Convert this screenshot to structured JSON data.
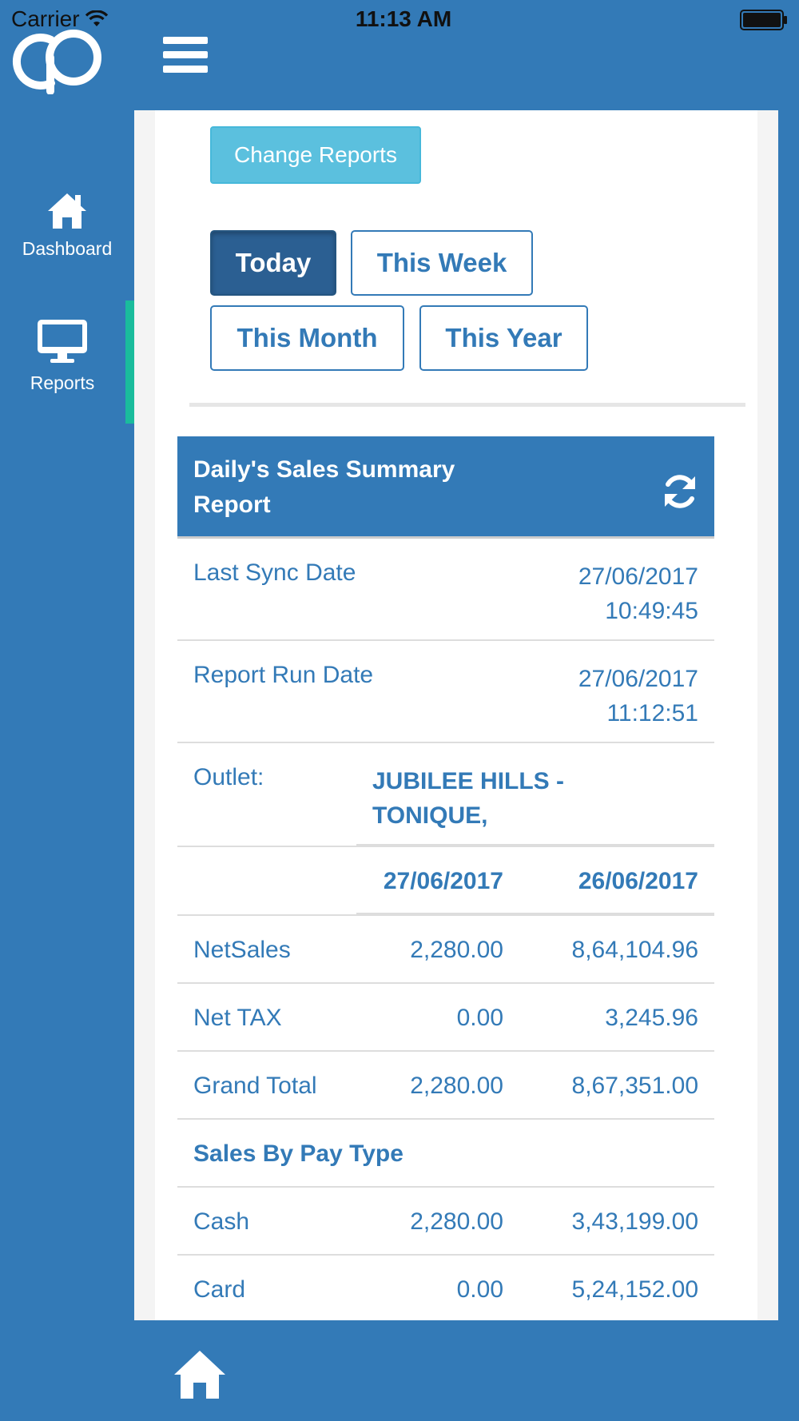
{
  "status_bar": {
    "carrier": "Carrier",
    "time": "11:13 AM"
  },
  "sidebar": {
    "items": [
      {
        "label": "Dashboard",
        "icon": "home-icon"
      },
      {
        "label": "Reports",
        "icon": "monitor-icon",
        "active": true
      }
    ]
  },
  "toolbar": {
    "change_reports_label": "Change Reports"
  },
  "periods": {
    "today": "Today",
    "this_week": "This Week",
    "this_month": "This Month",
    "this_year": "This Year",
    "selected": "Today"
  },
  "report": {
    "title_line1": "Daily's Sales Summary",
    "title_line2": "Report",
    "last_sync_label": "Last Sync Date",
    "last_sync_date": "27/06/2017",
    "last_sync_time": "10:49:45",
    "run_label": "Report Run Date",
    "run_date": "27/06/2017",
    "run_time": "11:12:51",
    "outlet_label": "Outlet:",
    "outlet_line1": "JUBILEE HILLS -",
    "outlet_line2": "TONIQUE,",
    "columns": [
      "27/06/2017",
      "26/06/2017"
    ],
    "rows": [
      {
        "label": "NetSales",
        "v1": "2,280.00",
        "v2": "8,64,104.96"
      },
      {
        "label": "Net TAX",
        "v1": "0.00",
        "v2": "3,245.96"
      },
      {
        "label": "Grand Total",
        "v1": "2,280.00",
        "v2": "8,67,351.00"
      }
    ],
    "section_pay_type": "Sales By Pay Type",
    "pay_rows": [
      {
        "label": "Cash",
        "v1": "2,280.00",
        "v2": "3,43,199.00"
      },
      {
        "label": "Card",
        "v1": "0.00",
        "v2": "5,24,152.00"
      }
    ]
  },
  "colors": {
    "primary": "#337ab7",
    "info": "#5bc0de",
    "active_indicator": "#1abc9c"
  }
}
